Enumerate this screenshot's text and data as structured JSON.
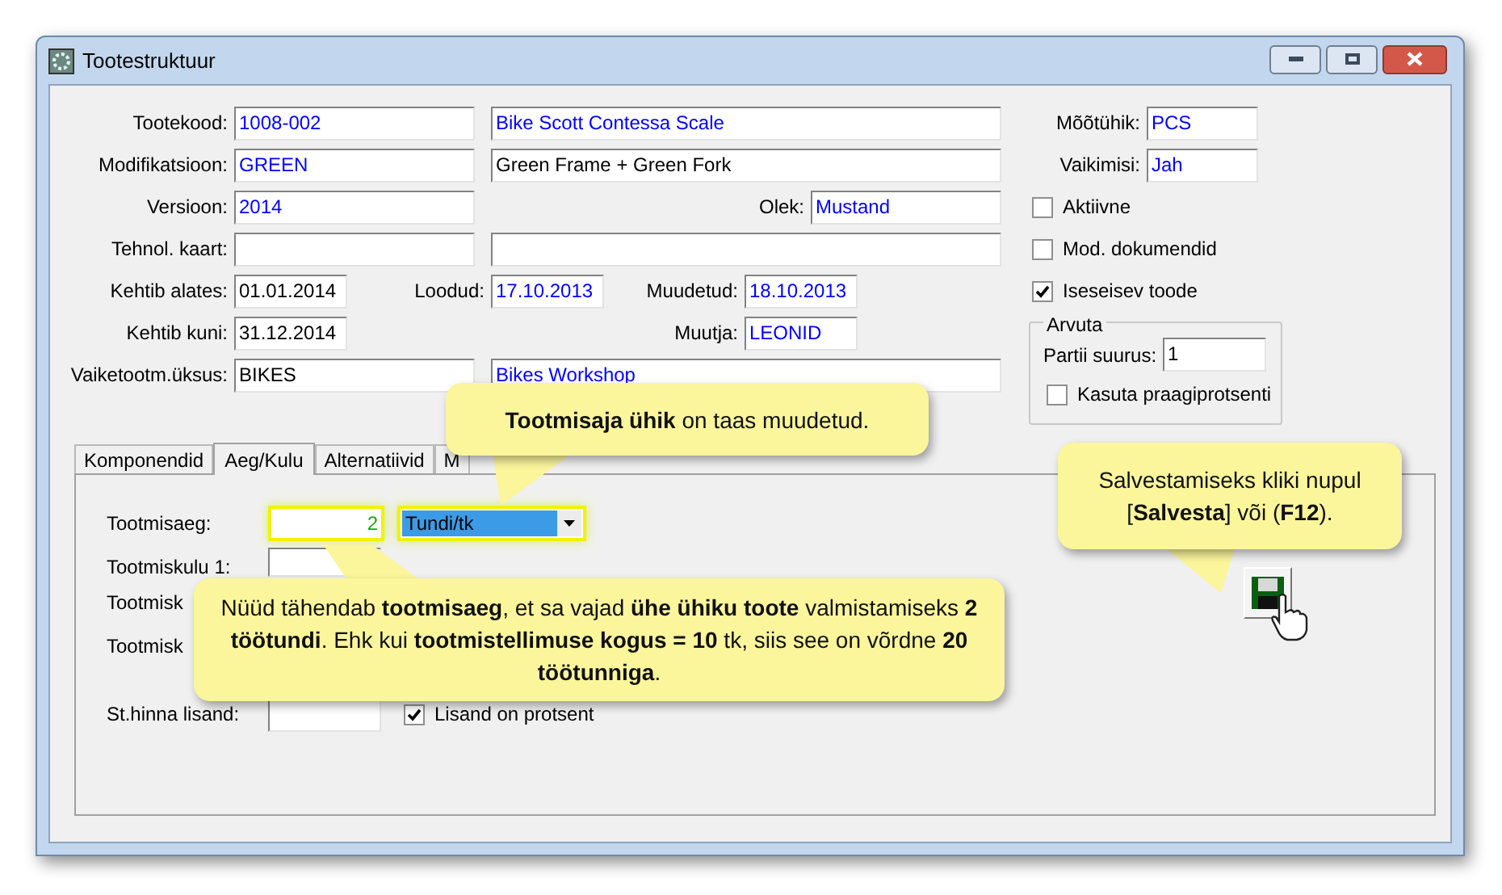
{
  "window": {
    "title": "Tootestruktuur"
  },
  "fields": {
    "product_code": {
      "label": "Tootekood:",
      "value": "1008-002",
      "kind": "linked"
    },
    "product_name": {
      "value": "Bike Scott Contessa Scale",
      "kind": "linked"
    },
    "modification": {
      "label": "Modifikatsioon:",
      "value": "GREEN",
      "kind": "linked"
    },
    "modification_name": {
      "value": "Green Frame + Green Fork",
      "kind": "plain"
    },
    "version": {
      "label": "Versioon:",
      "value": "2014",
      "kind": "linked"
    },
    "status": {
      "label": "Olek:",
      "value": "Mustand",
      "kind": "linked"
    },
    "tech_card": {
      "label": "Tehnol. kaart:"
    },
    "valid_from": {
      "label": "Kehtib alates:",
      "value": "01.01.2014",
      "kind": "plain"
    },
    "created": {
      "label": "Loodud:",
      "value": "17.10.2013",
      "kind": "linked"
    },
    "modified": {
      "label": "Muudetud:",
      "value": "18.10.2013",
      "kind": "linked"
    },
    "valid_to": {
      "label": "Kehtib kuni:",
      "value": "31.12.2014",
      "kind": "plain"
    },
    "modifier": {
      "label": "Muutja:",
      "value": "LEONID",
      "kind": "linked"
    },
    "default_unit": {
      "label": "Vaiketootm.üksus:",
      "value": "BIKES",
      "kind": "plain"
    },
    "default_unit_name": {
      "value": "Bikes Workshop",
      "kind": "linked"
    },
    "uom": {
      "label": "Mõõtühik:",
      "value": "PCS",
      "kind": "linked"
    },
    "default": {
      "label": "Vaikimisi:",
      "value": "Jah",
      "kind": "linked"
    }
  },
  "checkboxes": [
    {
      "label": "Aktiivne",
      "checked": false
    },
    {
      "label": "Mod. dokumendid",
      "checked": false
    },
    {
      "label": "Iseseisev toode",
      "checked": true
    }
  ],
  "calc_group": {
    "title": "Arvuta",
    "batch": {
      "label": "Partii suurus:",
      "value": "1"
    },
    "scrap": {
      "label": "Kasuta praagiprotsenti",
      "checked": false
    }
  },
  "tabs": [
    {
      "label": "Komponendid",
      "selected": false
    },
    {
      "label": "Aeg/Kulu",
      "selected": true
    },
    {
      "label": "Alternatiivid",
      "selected": false
    },
    {
      "label": "M",
      "selected": false
    }
  ],
  "time_cost": {
    "production_time": {
      "label": "Tootmisaeg:",
      "value": "2",
      "unit": "Tundi/tk"
    },
    "cost_rows": [
      {
        "label": "Tootmiskulu 1:"
      },
      {
        "label": "Tootmisk"
      },
      {
        "label": "Tootmisk"
      }
    ],
    "surcharge": {
      "label": "St.hinna lisand:",
      "percent": {
        "label": "Lisand on protsent",
        "checked": true
      }
    }
  },
  "callouts": [
    {
      "text": "**Tootmisaja ühik** on taas muudetud."
    },
    {
      "text": "Nüüd tähendab **tootmisaeg**, et sa vajad **ühe ühiku toote** valmistamiseks **2 töötundi**. Ehk kui **tootmistellimuse kogus = 10** tk, siis see on võrdne **20 töötunniga**."
    },
    {
      "text": "Salvestamiseks kliki nupul [**Salvesta**] või (**F12**)."
    }
  ]
}
